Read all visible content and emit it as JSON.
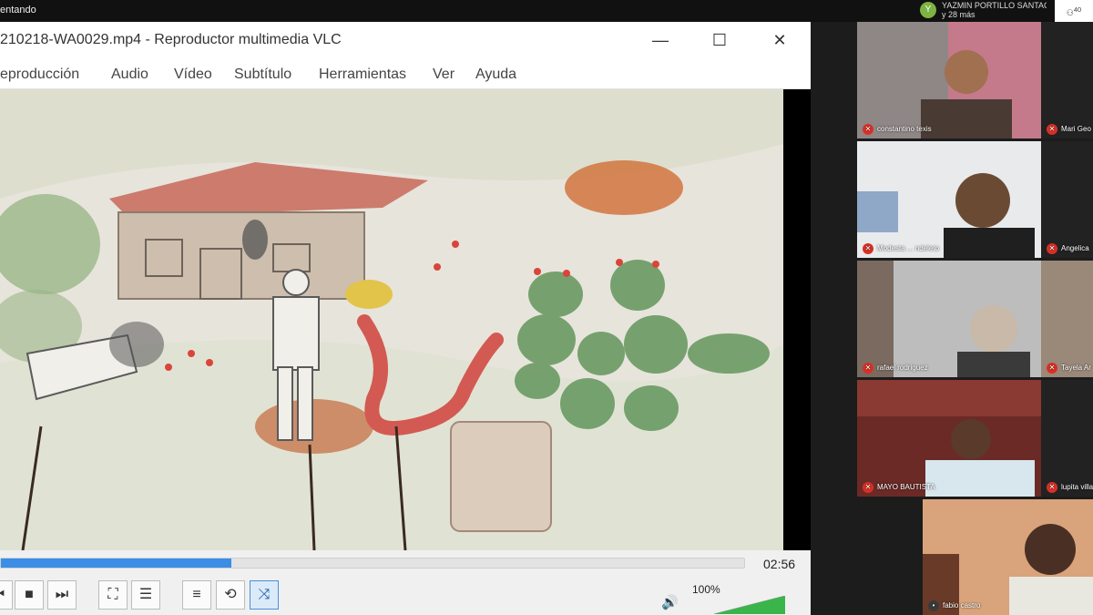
{
  "meet": {
    "presenting_text": "entando",
    "presenter_initial": "Y",
    "presenter_name": "YAZMIN PORTILLO SANTAC...",
    "presenter_more": "y 28 más",
    "people_count": "40"
  },
  "vlc": {
    "title": "210218-WA0029.mp4 - Reproductor multimedia VLC",
    "window_buttons": {
      "minimize": "—",
      "maximize": "☐",
      "close": "✕"
    },
    "menu": [
      "eproducción",
      "Audio",
      "Vídeo",
      "Subtítulo",
      "Herramientas",
      "Ver",
      "Ayuda"
    ],
    "time": "02:56",
    "progress": 0.31,
    "volume_label": "100%",
    "volume": 1.0,
    "accent_color": "#3a8ee6"
  },
  "participants": [
    {
      "name": "constantino texis"
    },
    {
      "name": "Mari Geo"
    },
    {
      "name": "Modesta ... ndeleto"
    },
    {
      "name": "Angelica"
    },
    {
      "name": "rafael rodriguez"
    },
    {
      "name": "Tayela Ar"
    },
    {
      "name": "MAYO BAUTISTA"
    },
    {
      "name": "lupita villa"
    },
    {
      "name": "fabio castro"
    }
  ]
}
